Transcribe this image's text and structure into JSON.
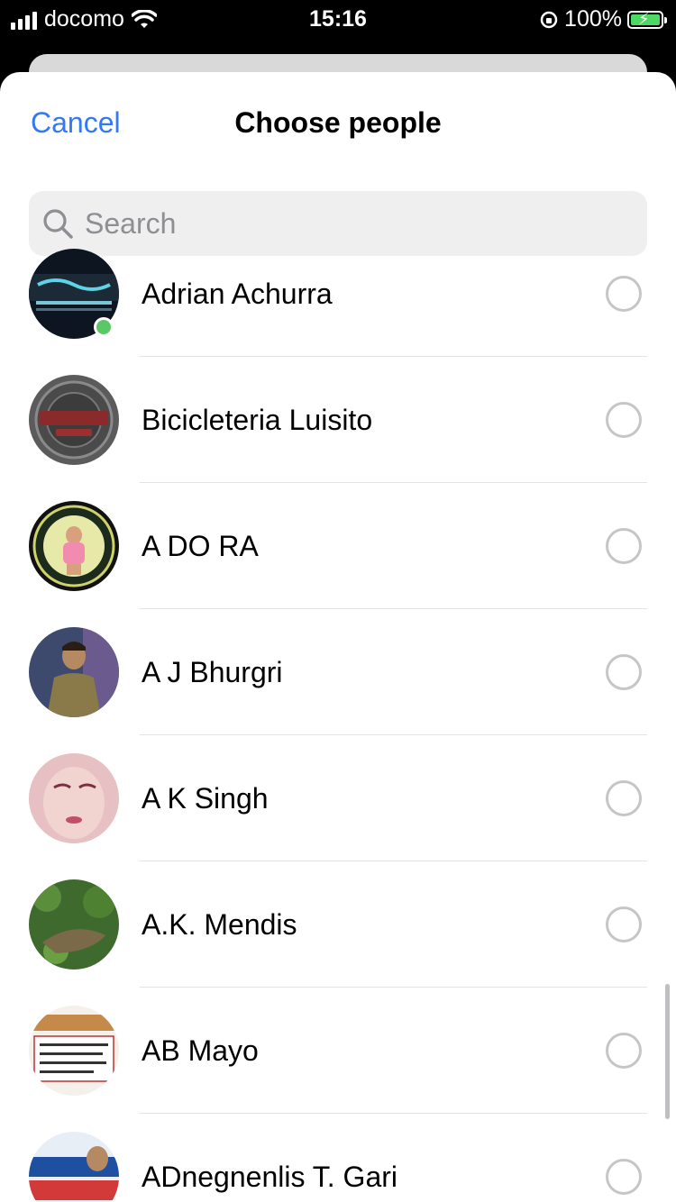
{
  "status_bar": {
    "carrier": "docomo",
    "time": "15:16",
    "battery": "100%"
  },
  "header": {
    "cancel_label": "Cancel",
    "title": "Choose people"
  },
  "search": {
    "placeholder": "Search"
  },
  "contacts": [
    {
      "name": "Adrian Achurra",
      "online": true,
      "selected": false
    },
    {
      "name": " Bicicleteria Luisito",
      "online": false,
      "selected": false
    },
    {
      "name": "A DO RA",
      "online": false,
      "selected": false
    },
    {
      "name": "A J Bhurgri",
      "online": false,
      "selected": false
    },
    {
      "name": "A K Singh",
      "online": false,
      "selected": false
    },
    {
      "name": "A.K. Mendis",
      "online": false,
      "selected": false
    },
    {
      "name": "AB Mayo",
      "online": false,
      "selected": false
    },
    {
      "name": "ADnegnenlis T. Gari",
      "online": false,
      "selected": false
    }
  ],
  "colors": {
    "accent": "#3478f6",
    "online": "#5ac864"
  }
}
